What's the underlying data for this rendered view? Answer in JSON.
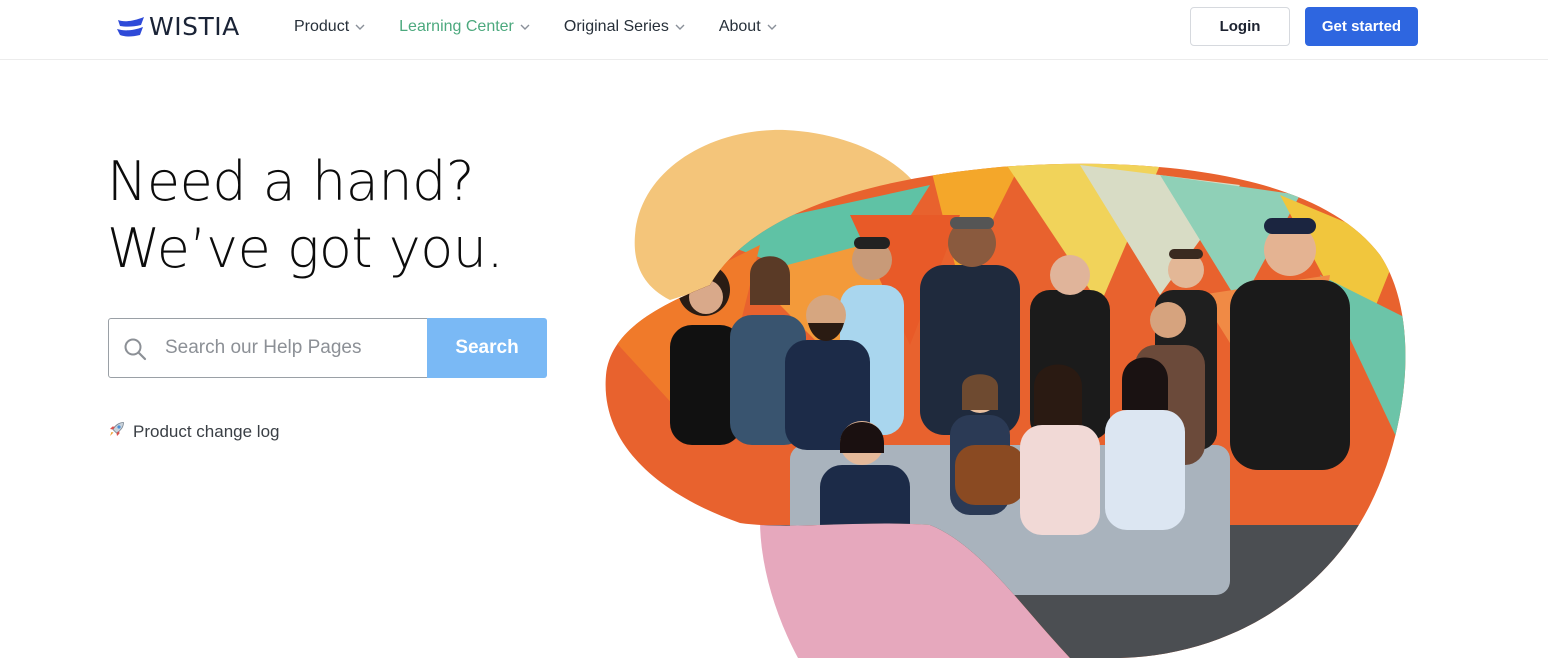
{
  "header": {
    "logo": {
      "text": "WISTIA",
      "icon": "wistia-wave-icon",
      "color": "#2e4ad8"
    },
    "nav": [
      {
        "label": "Product",
        "active": false
      },
      {
        "label": "Learning Center",
        "active": true
      },
      {
        "label": "Original Series",
        "active": false
      },
      {
        "label": "About",
        "active": false
      }
    ],
    "login_label": "Login",
    "cta_label": "Get started"
  },
  "hero": {
    "headline_line1": "Need a hand?",
    "headline_line2": "We’ve got you.",
    "search": {
      "placeholder": "Search our Help Pages",
      "value": "",
      "button_label": "Search"
    },
    "changelog": {
      "icon": "rocket-icon",
      "label": "Product change log"
    }
  },
  "illustration": {
    "description_icon": "team-photo-image",
    "colors": {
      "yellow_blob": "#f4c57a",
      "pink_blob": "#e6a8bd",
      "accent": "#4ca97e",
      "cta": "#2e66e0",
      "search_button": "#7ab9f5"
    }
  }
}
